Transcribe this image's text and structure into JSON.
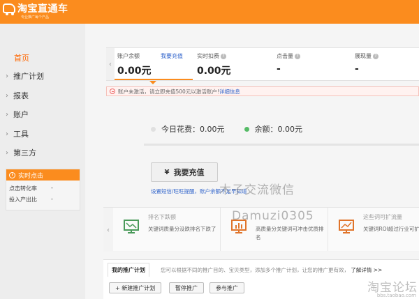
{
  "header": {
    "logo_title": "淘宝直通车",
    "logo_subtitle": "专业推广每个产品"
  },
  "sidebar": {
    "items": [
      {
        "label": "首页",
        "active": true
      },
      {
        "label": "推广计划"
      },
      {
        "label": "报表"
      },
      {
        "label": "账户"
      },
      {
        "label": "工具"
      },
      {
        "label": "第三方"
      }
    ],
    "realtime": {
      "title": "实时点击",
      "rows": [
        {
          "label": "点击转化率",
          "value": "-"
        },
        {
          "label": "投入产出比",
          "value": "-"
        }
      ]
    }
  },
  "metrics": [
    {
      "label": "账户余额",
      "value": "0.00元",
      "link": "我要充值"
    },
    {
      "label": "实时扣费",
      "value": "0.00元"
    },
    {
      "label": "点击量",
      "value": "-"
    },
    {
      "label": "展现量",
      "value": "-"
    }
  ],
  "notice": {
    "text": "账户未激活，请立即充值500元以激活账户!",
    "link": "详细信息"
  },
  "spend": {
    "today_label": "今日花费：",
    "today_value": "0.00元",
    "balance_label": "余额：",
    "balance_value": "0.00元",
    "dot_gray": "#e0e0e0",
    "dot_green": "#55bb66"
  },
  "recharge": {
    "button": "我要充值",
    "links": "设置短信/旺旺提醒，账户余额不足早知道"
  },
  "watermark": {
    "line1": "木子交流微信",
    "line2": "Damuzi0305",
    "bottom": "淘宝论坛",
    "bottom_sub": "bbs.taobao.com"
  },
  "cards": [
    {
      "title": "排名下跌额",
      "desc": "关键词质量分没跌排名下跌了",
      "icon": "chart-down-icon"
    },
    {
      "title": "",
      "desc": "高质量分关键词可冲击优质排名",
      "icon": "bar-chart-icon"
    },
    {
      "title": "这些词可扩流量",
      "desc": "关键词ROI超过行业可扩流量",
      "icon": "trend-up-icon"
    }
  ],
  "plans": {
    "tab": "我的推广计划",
    "tip": "您可以根据不同的推广目的、宝贝类型，添加多个推广计划，让您的推广更有效，",
    "tip_link": "了解详情 >>",
    "buttons": [
      "+ 新建推广计划",
      "暂停推广",
      "参与推广"
    ]
  }
}
